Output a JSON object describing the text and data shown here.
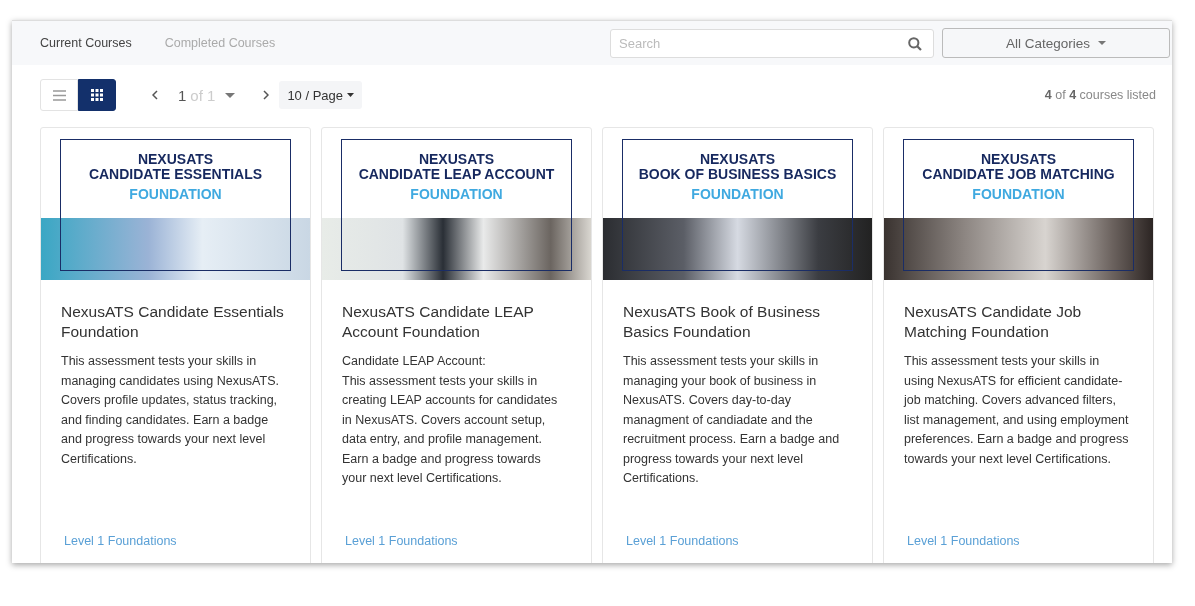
{
  "tabs": [
    {
      "label": "Current Courses",
      "selected": true
    },
    {
      "label": "Completed Courses",
      "selected": false
    }
  ],
  "search": {
    "placeholder": "Search"
  },
  "category_filter": {
    "label": "All Categories"
  },
  "view_modes": [
    {
      "kind": "list",
      "selected": false
    },
    {
      "kind": "grid",
      "selected": true
    }
  ],
  "pagination": {
    "page": "1",
    "of": "of 1",
    "page_size": "10 / Page"
  },
  "count": "**4** of **4** courses listed",
  "courses": [
    {
      "banner_brand": "NEXUSATS",
      "banner_title": "CANDIDATE ESSENTIALS",
      "banner_level": "FOUNDATION",
      "title": "NexusATS Candidate Essentials Foundation",
      "description": "This assessment tests your skills in managing candidates using NexusATS. Covers profile updates, status tracking, and finding candidates. Earn a badge and progress towards your next level Certifications.",
      "level": "Level 1 Foundations"
    },
    {
      "banner_brand": "NEXUSATS",
      "banner_title": "CANDIDATE LEAP ACCOUNT",
      "banner_level": "FOUNDATION",
      "title": "NexusATS Candidate LEAP Account Foundation",
      "description": "Candidate LEAP Account:\nThis assessment tests your skills in creating LEAP accounts for candidates in NexusATS. Covers account setup, data entry, and profile management. Earn a badge and progress towards your next level Certifications.",
      "level": "Level 1 Foundations"
    },
    {
      "banner_brand": "NEXUSATS",
      "banner_title": "BOOK OF BUSINESS BASICS",
      "banner_level": "FOUNDATION",
      "title": "NexusATS Book of Business Basics Foundation",
      "description": "This assessment tests your skills in managing your book of business in NexusATS. Covers day-to-day managment of candiadate and the recruitment process. Earn a badge and progress towards your next level Certifications.",
      "level": "Level 1 Foundations"
    },
    {
      "banner_brand": "NEXUSATS",
      "banner_title": "CANDIDATE JOB MATCHING",
      "banner_level": "FOUNDATION",
      "title": "NexusATS Candidate Job Matching Foundation",
      "description": "This assessment tests your skills in using NexusATS for efficient candidate-job matching. Covers advanced filters, list management, and using employment preferences. Earn a badge and progress towards your next level Certifications.",
      "level": "Level 1 Foundations"
    }
  ]
}
